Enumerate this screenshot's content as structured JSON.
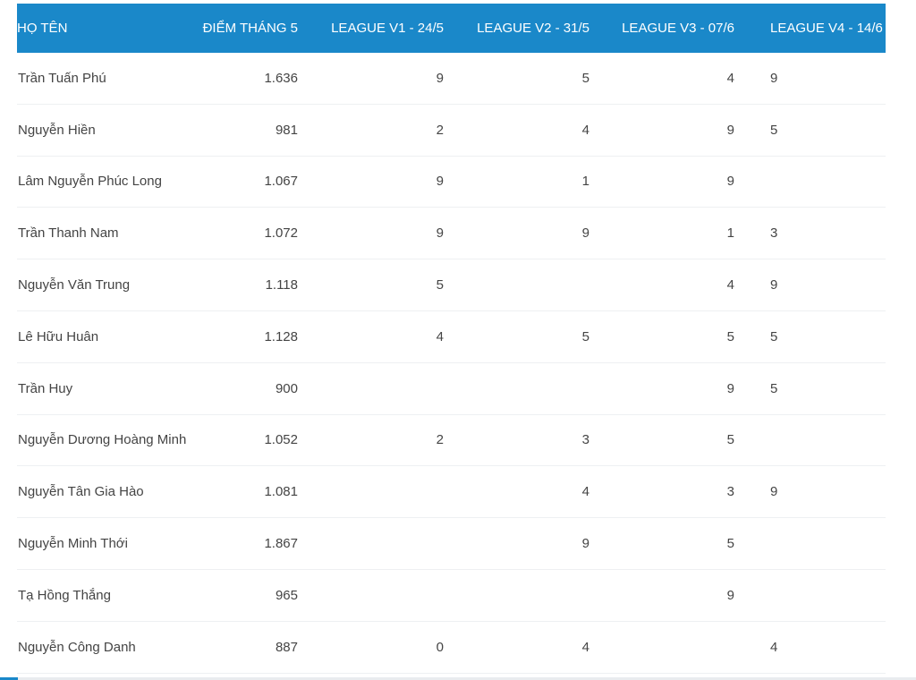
{
  "table": {
    "headers": {
      "name": "HỌ TÊN",
      "score": "ĐIỂM THÁNG 5",
      "v1": "LEAGUE V1 - 24/5",
      "v2": "LEAGUE V2 - 31/5",
      "v3": "LEAGUE V3 - 07/6",
      "v4": "LEAGUE V4 - 14/6"
    },
    "rows": [
      {
        "name": "Trần Tuấn Phú",
        "score": "1.636",
        "v1": "9",
        "v2": "5",
        "v3": "4",
        "v4": "9"
      },
      {
        "name": "Nguyễn Hiền",
        "score": "981",
        "v1": "2",
        "v2": "4",
        "v3": "9",
        "v4": "5"
      },
      {
        "name": "Lâm Nguyễn Phúc Long",
        "score": "1.067",
        "v1": "9",
        "v2": "1",
        "v3": "9",
        "v4": ""
      },
      {
        "name": "Trần Thanh Nam",
        "score": "1.072",
        "v1": "9",
        "v2": "9",
        "v3": "1",
        "v4": "3"
      },
      {
        "name": "Nguyễn Văn Trung",
        "score": "1.118",
        "v1": "5",
        "v2": "",
        "v3": "4",
        "v4": "9"
      },
      {
        "name": "Lê Hữu Huân",
        "score": "1.128",
        "v1": "4",
        "v2": "5",
        "v3": "5",
        "v4": "5"
      },
      {
        "name": "Trần Huy",
        "score": "900",
        "v1": "",
        "v2": "",
        "v3": "9",
        "v4": "5"
      },
      {
        "name": "Nguyễn Dương Hoàng Minh",
        "score": "1.052",
        "v1": "2",
        "v2": "3",
        "v3": "5",
        "v4": ""
      },
      {
        "name": "Nguyễn Tân Gia Hào",
        "score": "1.081",
        "v1": "",
        "v2": "4",
        "v3": "3",
        "v4": "9"
      },
      {
        "name": "Nguyễn Minh Thới",
        "score": "1.867",
        "v1": "",
        "v2": "9",
        "v3": "5",
        "v4": ""
      },
      {
        "name": "Tạ Hồng Thắng",
        "score": "965",
        "v1": "",
        "v2": "",
        "v3": "9",
        "v4": ""
      },
      {
        "name": "Nguyễn Công Danh",
        "score": "887",
        "v1": "0",
        "v2": "4",
        "v3": "",
        "v4": "4"
      }
    ]
  },
  "colors": {
    "header_bg": "#1a88c9",
    "header_text": "#ffffff",
    "cell_text": "#444444",
    "row_border": "#eef0f2"
  }
}
